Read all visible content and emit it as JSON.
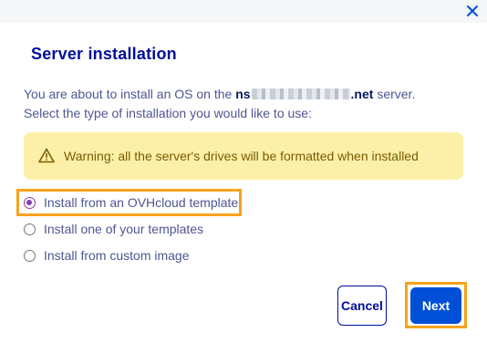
{
  "dialog": {
    "title": "Server installation",
    "close_icon": "close-icon"
  },
  "description": {
    "line1_prefix": "You are about to install an OS on the ",
    "server_name_start": "ns",
    "server_name_end": ".net",
    "line1_suffix": " server.",
    "line2": "Select the type of installation you would like to use:"
  },
  "warning": {
    "icon": "warning-triangle-icon",
    "text": "Warning: all the server's drives will be formatted when installed",
    "bg_color": "#fcf0a8"
  },
  "options": [
    {
      "label": "Install from an OVHcloud template",
      "selected": true
    },
    {
      "label": "Install one of your templates",
      "selected": false
    },
    {
      "label": "Install from custom image",
      "selected": false
    }
  ],
  "buttons": {
    "cancel": "Cancel",
    "next": "Next"
  },
  "colors": {
    "primary": "#0050d7",
    "title": "#000e9c",
    "highlight": "#f7a21b"
  }
}
